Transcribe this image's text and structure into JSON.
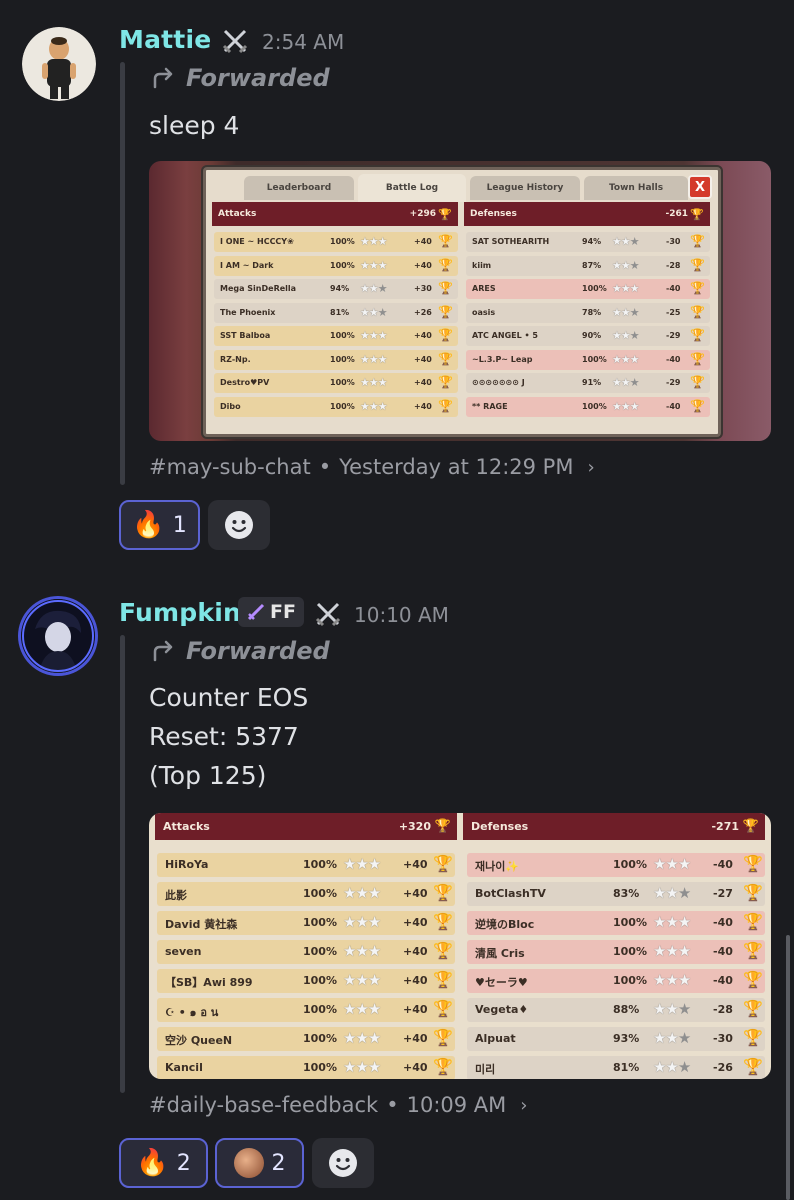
{
  "messages": [
    {
      "username": "Mattie",
      "time": "2:54 AM",
      "forwarded_label": "Forwarded",
      "text_lines": [
        "sleep 4"
      ],
      "source": {
        "channel": "#may-sub-chat",
        "when": "Yesterday at 12:29 PM"
      },
      "reactions": [
        {
          "emoji": "fire",
          "count": "1"
        }
      ],
      "screenshot": {
        "tabs": [
          "Leaderboard",
          "Battle Log",
          "League History",
          "Town Halls"
        ],
        "close": "X",
        "attacks_header": {
          "label": "Attacks",
          "total": "+296"
        },
        "defenses_header": {
          "label": "Defenses",
          "total": "-261"
        },
        "attacks": [
          {
            "name": "I ONE ~ HCCCY❀",
            "percent": "100%",
            "stars": 3,
            "trophies": "+40"
          },
          {
            "name": "I AM ~ Dark",
            "percent": "100%",
            "stars": 3,
            "trophies": "+40"
          },
          {
            "name": "Mega SinDeRella",
            "percent": "94%",
            "stars": 2,
            "trophies": "+30"
          },
          {
            "name": "The Phoenix",
            "percent": "81%",
            "stars": 2,
            "trophies": "+26"
          },
          {
            "name": "SST Balboa",
            "percent": "100%",
            "stars": 3,
            "trophies": "+40"
          },
          {
            "name": "RZ-Np.",
            "percent": "100%",
            "stars": 3,
            "trophies": "+40"
          },
          {
            "name": "Destro♥PV",
            "percent": "100%",
            "stars": 3,
            "trophies": "+40"
          },
          {
            "name": "Dibo",
            "percent": "100%",
            "stars": 3,
            "trophies": "+40"
          }
        ],
        "defenses": [
          {
            "name": "SAT SOTHEARITH",
            "percent": "94%",
            "stars": 2,
            "trophies": "-30"
          },
          {
            "name": "kiim",
            "percent": "87%",
            "stars": 2,
            "trophies": "-28"
          },
          {
            "name": "ARES",
            "percent": "100%",
            "stars": 3,
            "trophies": "-40"
          },
          {
            "name": "oasis",
            "percent": "78%",
            "stars": 2,
            "trophies": "-25"
          },
          {
            "name": "ATC ANGEL • 5",
            "percent": "90%",
            "stars": 2,
            "trophies": "-29"
          },
          {
            "name": "~L.3.P~ Leap",
            "percent": "100%",
            "stars": 3,
            "trophies": "-40"
          },
          {
            "name": "⊙⊙⊙⊙⊙⊙⊙ J",
            "percent": "91%",
            "stars": 2,
            "trophies": "-29"
          },
          {
            "name": "** RAGE",
            "percent": "100%",
            "stars": 3,
            "trophies": "-40"
          }
        ]
      }
    },
    {
      "username": "Fumpkin",
      "tag": "FF",
      "time": "10:10 AM",
      "forwarded_label": "Forwarded",
      "text_lines": [
        "Counter EOS",
        "Reset: 5377",
        "(Top 125)"
      ],
      "source": {
        "channel": "#daily-base-feedback",
        "when": "10:09 AM"
      },
      "reactions": [
        {
          "emoji": "flames",
          "count": "2"
        },
        {
          "emoji": "crying-face",
          "count": "2"
        }
      ],
      "screenshot": {
        "attacks_header": {
          "label": "Attacks",
          "total": "+320"
        },
        "defenses_header": {
          "label": "Defenses",
          "total": "-271"
        },
        "attacks": [
          {
            "name": "HiRoYa",
            "percent": "100%",
            "stars": 3,
            "trophies": "+40"
          },
          {
            "name": "此影",
            "percent": "100%",
            "stars": 3,
            "trophies": "+40"
          },
          {
            "name": "David 黄社森",
            "percent": "100%",
            "stars": 3,
            "trophies": "+40"
          },
          {
            "name": "seven",
            "percent": "100%",
            "stars": 3,
            "trophies": "+40"
          },
          {
            "name": "【SB】Awi 899",
            "percent": "100%",
            "stars": 3,
            "trophies": "+40"
          },
          {
            "name": "☪ • ๑ อ น",
            "percent": "100%",
            "stars": 3,
            "trophies": "+40"
          },
          {
            "name": "空沙 QueeN",
            "percent": "100%",
            "stars": 3,
            "trophies": "+40"
          },
          {
            "name": "Kancil",
            "percent": "100%",
            "stars": 3,
            "trophies": "+40"
          }
        ],
        "defenses": [
          {
            "name": "재나이✨",
            "percent": "100%",
            "stars": 3,
            "trophies": "-40"
          },
          {
            "name": "BotClashTV",
            "percent": "83%",
            "stars": 2,
            "trophies": "-27"
          },
          {
            "name": "逆境のBloc",
            "percent": "100%",
            "stars": 3,
            "trophies": "-40"
          },
          {
            "name": "清風 Cris",
            "percent": "100%",
            "stars": 3,
            "trophies": "-40"
          },
          {
            "name": "♥セーラ♥",
            "percent": "100%",
            "stars": 3,
            "trophies": "-40"
          },
          {
            "name": "Vegeta♦",
            "percent": "88%",
            "stars": 2,
            "trophies": "-28"
          },
          {
            "name": "Alpuat",
            "percent": "93%",
            "stars": 2,
            "trophies": "-30"
          },
          {
            "name": "미리",
            "percent": "81%",
            "stars": 2,
            "trophies": "-26"
          }
        ]
      }
    }
  ]
}
